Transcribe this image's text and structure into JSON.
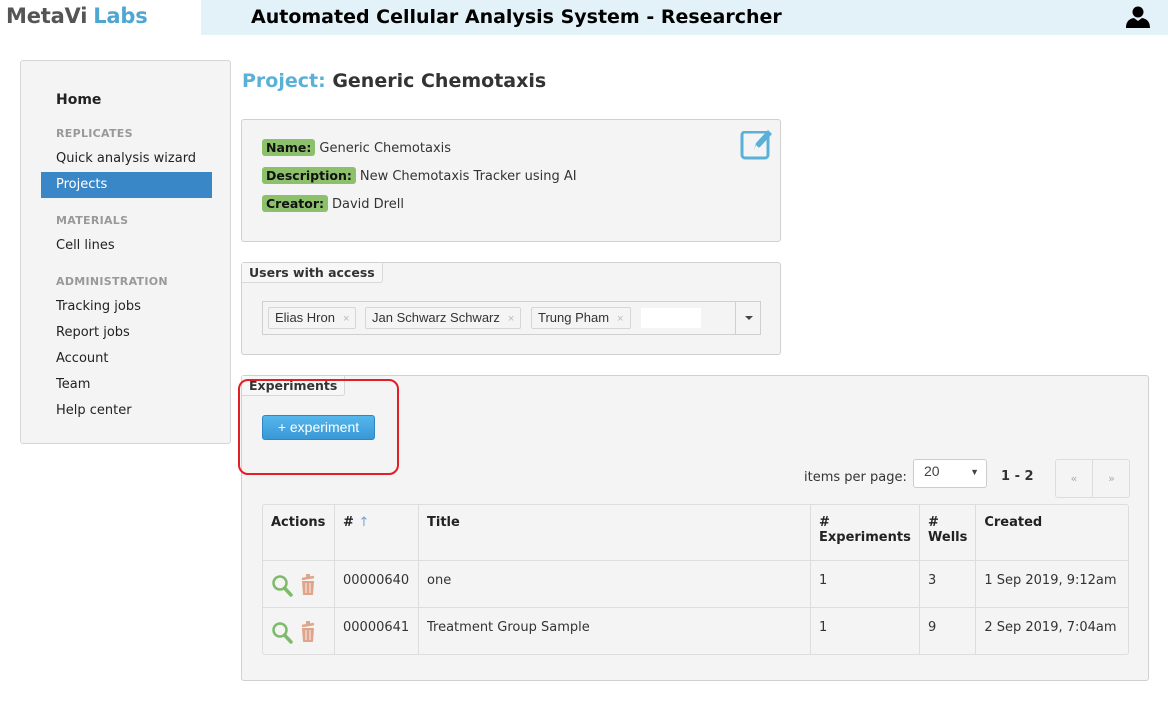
{
  "header": {
    "logo_part1": "MetaVi",
    "logo_part2": "Labs",
    "app_title": "Automated Cellular Analysis System - Researcher",
    "user_icon": "user-icon"
  },
  "sidebar": {
    "home": "Home",
    "sections": [
      {
        "heading": "REPLICATES",
        "items": [
          "Quick analysis wizard",
          "Projects"
        ]
      },
      {
        "heading": "MATERIALS",
        "items": [
          "Cell lines"
        ]
      },
      {
        "heading": "ADMINISTRATION",
        "items": [
          "Tracking jobs",
          "Report jobs",
          "Account",
          "Team",
          "Help center"
        ]
      }
    ],
    "active_item": "Projects"
  },
  "page": {
    "title_label": "Project:",
    "title_value": "Generic Chemotaxis"
  },
  "info": {
    "name_label": "Name:",
    "name_value": "Generic Chemotaxis",
    "description_label": "Description:",
    "description_value": "New Chemotaxis Tracker using AI",
    "creator_label": "Creator:",
    "creator_value": "David Drell",
    "edit_icon": "edit-icon"
  },
  "users": {
    "legend": "Users with access",
    "selected": [
      "Elias Hron",
      "Jan Schwarz Schwarz",
      "Trung Pham"
    ],
    "remove_glyph": "×"
  },
  "experiments": {
    "legend": "Experiments",
    "add_button": "+ experiment",
    "items_per_page_label": "items per page:",
    "items_per_page_value": "20",
    "range": "1 - 2",
    "prev": "«",
    "next": "»",
    "columns": [
      "Actions",
      "#",
      "Title",
      "# Experiments",
      "# Wells",
      "Created"
    ],
    "sort_indicator": "↑",
    "rows": [
      {
        "id": "00000640",
        "title": "one",
        "experiments": "1",
        "wells": "3",
        "created": "1 Sep 2019, 9:12am"
      },
      {
        "id": "00000641",
        "title": "Treatment Group Sample",
        "experiments": "1",
        "wells": "9",
        "created": "2 Sep 2019, 7:04am"
      }
    ]
  },
  "colors": {
    "accent": "#3a87c8",
    "title_label": "#5bb0d8",
    "tag_green": "#8dc06a",
    "view_icon": "#7dbb6a",
    "delete_icon": "#e0a48a",
    "highlight": "#e41e26"
  }
}
